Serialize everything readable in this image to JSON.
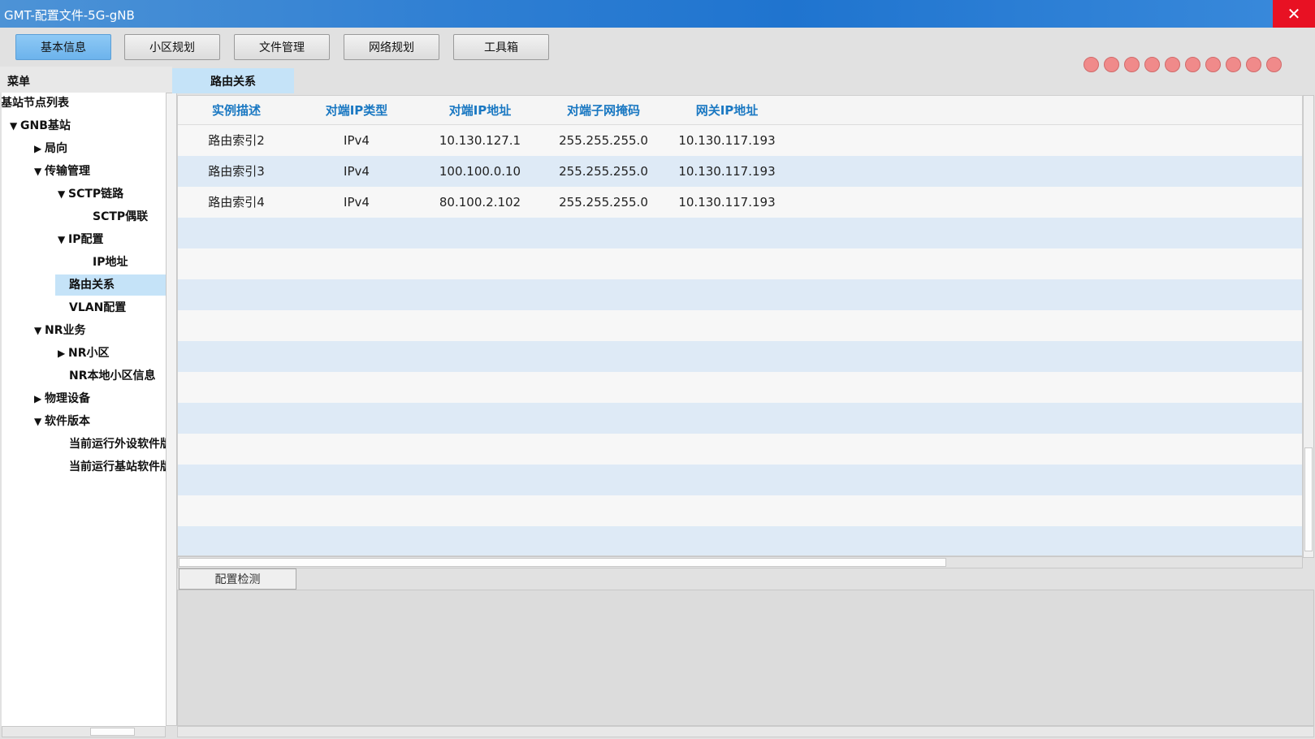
{
  "window": {
    "title": "GMT-配置文件-5G-gNB",
    "close_label": "✕"
  },
  "toolbar": {
    "buttons": [
      {
        "label": "基本信息",
        "active": true
      },
      {
        "label": "小区规划"
      },
      {
        "label": "文件管理"
      },
      {
        "label": "网络规划"
      },
      {
        "label": "工具箱"
      }
    ],
    "status_dot_color": "#f08a8a",
    "status_dot_count": 10
  },
  "menu": {
    "header": "菜单",
    "items": [
      {
        "label": "基站节点列表",
        "toggle": ""
      },
      {
        "label": "GNB基站",
        "toggle": "▼"
      },
      {
        "label": "局向",
        "toggle": "▶"
      },
      {
        "label": "传输管理",
        "toggle": "▼"
      },
      {
        "label": "SCTP链路",
        "toggle": "▼"
      },
      {
        "label": "SCTP偶联",
        "toggle": ""
      },
      {
        "label": "IP配置",
        "toggle": "▼"
      },
      {
        "label": "IP地址",
        "toggle": ""
      },
      {
        "label": "路由关系",
        "toggle": "",
        "selected": true
      },
      {
        "label": "VLAN配置",
        "toggle": ""
      },
      {
        "label": "NR业务",
        "toggle": "▼"
      },
      {
        "label": "NR小区",
        "toggle": "▶"
      },
      {
        "label": "NR本地小区信息",
        "toggle": ""
      },
      {
        "label": "物理设备",
        "toggle": "▶"
      },
      {
        "label": "软件版本",
        "toggle": "▼"
      },
      {
        "label": "当前运行外设软件版本",
        "toggle": ""
      },
      {
        "label": "当前运行基站软件版本",
        "toggle": ""
      }
    ]
  },
  "main": {
    "tab_label": "路由关系",
    "table": {
      "columns": [
        "实例描述",
        "对端IP类型",
        "对端IP地址",
        "对端子网掩码",
        "网关IP地址"
      ],
      "rows": [
        [
          "路由索引2",
          "IPv4",
          "10.130.127.1",
          "255.255.255.0",
          "10.130.117.193"
        ],
        [
          "路由索引3",
          "IPv4",
          "100.100.0.10",
          "255.255.255.0",
          "10.130.117.193"
        ],
        [
          "路由索引4",
          "IPv4",
          "80.100.2.102",
          "255.255.255.0",
          "10.130.117.193"
        ]
      ],
      "header_color": "#1a78c2",
      "stripe_color": "#deeaf6"
    }
  },
  "bottom_panel": {
    "tab_label": "配置检测"
  }
}
